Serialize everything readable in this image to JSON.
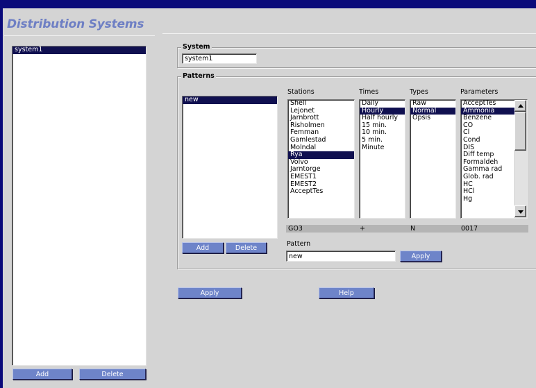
{
  "app": {
    "title": "Distribution Systems"
  },
  "systems": {
    "items": [
      "system1"
    ],
    "selected": 0,
    "add_label": "Add",
    "delete_label": "Delete"
  },
  "system_group": {
    "label": "System",
    "name_value": "system1"
  },
  "patterns_group": {
    "label": "Patterns",
    "pattern_items": [
      "new"
    ],
    "selected": 0,
    "add_label": "Add",
    "delete_label": "Delete",
    "columns": {
      "stations": {
        "header": "Stations",
        "items": [
          "Shell",
          "Lejonet",
          "Jarnbrott",
          "Risholmen",
          "Femman",
          "Gamlestad",
          "Molndal",
          "Rya",
          "Volvo",
          "Jarntorge",
          "EMEST1",
          "EMEST2",
          "AcceptTes"
        ],
        "selected": 7,
        "status": "GO3"
      },
      "times": {
        "header": "Times",
        "items": [
          "Daily",
          "Hourly",
          "Half hourly",
          "15 min.",
          "10 min.",
          "5 min.",
          "Minute"
        ],
        "selected": 1,
        "status": "+"
      },
      "types": {
        "header": "Types",
        "items": [
          "Raw",
          "Normal",
          "Opsis"
        ],
        "selected": 1,
        "status": "N"
      },
      "parameters": {
        "header": "Parameters",
        "items": [
          "AcceptTes",
          "Ammonia",
          "Benzene",
          "CO",
          "Cl",
          "Cond",
          "DIS",
          "Diff temp",
          "Formaldeh",
          "Gamma rad",
          "Glob. rad",
          "HC",
          "HCl",
          "Hg"
        ],
        "selected": 1,
        "status": "0017"
      }
    },
    "pattern_label": "Pattern",
    "pattern_value": "new",
    "apply_label": "Apply"
  },
  "footer": {
    "apply_label": "Apply",
    "help_label": "Help"
  },
  "colors": {
    "frame_border": "#0a0a7a",
    "title": "#6e7fc4",
    "button": "#6e84c9",
    "selection": "#101050"
  }
}
